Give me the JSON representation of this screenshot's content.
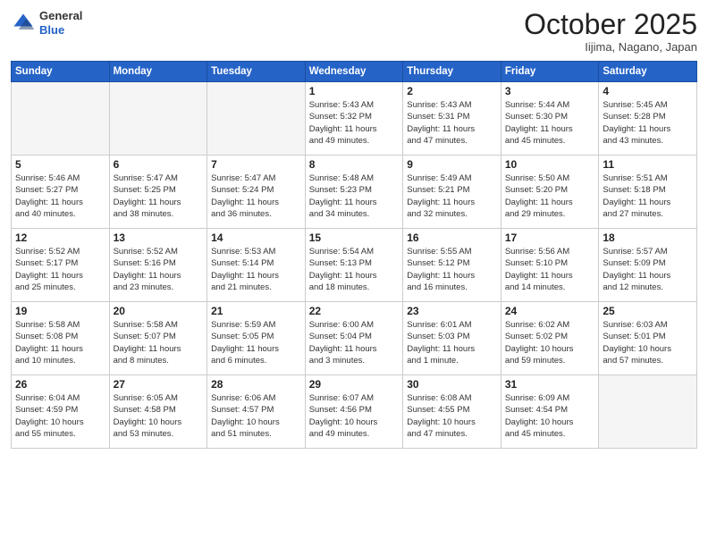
{
  "header": {
    "logo_line1": "General",
    "logo_line2": "Blue",
    "month": "October 2025",
    "location": "Iijima, Nagano, Japan"
  },
  "weekdays": [
    "Sunday",
    "Monday",
    "Tuesday",
    "Wednesday",
    "Thursday",
    "Friday",
    "Saturday"
  ],
  "weeks": [
    [
      {
        "day": "",
        "info": ""
      },
      {
        "day": "",
        "info": ""
      },
      {
        "day": "",
        "info": ""
      },
      {
        "day": "1",
        "info": "Sunrise: 5:43 AM\nSunset: 5:32 PM\nDaylight: 11 hours\nand 49 minutes."
      },
      {
        "day": "2",
        "info": "Sunrise: 5:43 AM\nSunset: 5:31 PM\nDaylight: 11 hours\nand 47 minutes."
      },
      {
        "day": "3",
        "info": "Sunrise: 5:44 AM\nSunset: 5:30 PM\nDaylight: 11 hours\nand 45 minutes."
      },
      {
        "day": "4",
        "info": "Sunrise: 5:45 AM\nSunset: 5:28 PM\nDaylight: 11 hours\nand 43 minutes."
      }
    ],
    [
      {
        "day": "5",
        "info": "Sunrise: 5:46 AM\nSunset: 5:27 PM\nDaylight: 11 hours\nand 40 minutes."
      },
      {
        "day": "6",
        "info": "Sunrise: 5:47 AM\nSunset: 5:25 PM\nDaylight: 11 hours\nand 38 minutes."
      },
      {
        "day": "7",
        "info": "Sunrise: 5:47 AM\nSunset: 5:24 PM\nDaylight: 11 hours\nand 36 minutes."
      },
      {
        "day": "8",
        "info": "Sunrise: 5:48 AM\nSunset: 5:23 PM\nDaylight: 11 hours\nand 34 minutes."
      },
      {
        "day": "9",
        "info": "Sunrise: 5:49 AM\nSunset: 5:21 PM\nDaylight: 11 hours\nand 32 minutes."
      },
      {
        "day": "10",
        "info": "Sunrise: 5:50 AM\nSunset: 5:20 PM\nDaylight: 11 hours\nand 29 minutes."
      },
      {
        "day": "11",
        "info": "Sunrise: 5:51 AM\nSunset: 5:18 PM\nDaylight: 11 hours\nand 27 minutes."
      }
    ],
    [
      {
        "day": "12",
        "info": "Sunrise: 5:52 AM\nSunset: 5:17 PM\nDaylight: 11 hours\nand 25 minutes."
      },
      {
        "day": "13",
        "info": "Sunrise: 5:52 AM\nSunset: 5:16 PM\nDaylight: 11 hours\nand 23 minutes."
      },
      {
        "day": "14",
        "info": "Sunrise: 5:53 AM\nSunset: 5:14 PM\nDaylight: 11 hours\nand 21 minutes."
      },
      {
        "day": "15",
        "info": "Sunrise: 5:54 AM\nSunset: 5:13 PM\nDaylight: 11 hours\nand 18 minutes."
      },
      {
        "day": "16",
        "info": "Sunrise: 5:55 AM\nSunset: 5:12 PM\nDaylight: 11 hours\nand 16 minutes."
      },
      {
        "day": "17",
        "info": "Sunrise: 5:56 AM\nSunset: 5:10 PM\nDaylight: 11 hours\nand 14 minutes."
      },
      {
        "day": "18",
        "info": "Sunrise: 5:57 AM\nSunset: 5:09 PM\nDaylight: 11 hours\nand 12 minutes."
      }
    ],
    [
      {
        "day": "19",
        "info": "Sunrise: 5:58 AM\nSunset: 5:08 PM\nDaylight: 11 hours\nand 10 minutes."
      },
      {
        "day": "20",
        "info": "Sunrise: 5:58 AM\nSunset: 5:07 PM\nDaylight: 11 hours\nand 8 minutes."
      },
      {
        "day": "21",
        "info": "Sunrise: 5:59 AM\nSunset: 5:05 PM\nDaylight: 11 hours\nand 6 minutes."
      },
      {
        "day": "22",
        "info": "Sunrise: 6:00 AM\nSunset: 5:04 PM\nDaylight: 11 hours\nand 3 minutes."
      },
      {
        "day": "23",
        "info": "Sunrise: 6:01 AM\nSunset: 5:03 PM\nDaylight: 11 hours\nand 1 minute."
      },
      {
        "day": "24",
        "info": "Sunrise: 6:02 AM\nSunset: 5:02 PM\nDaylight: 10 hours\nand 59 minutes."
      },
      {
        "day": "25",
        "info": "Sunrise: 6:03 AM\nSunset: 5:01 PM\nDaylight: 10 hours\nand 57 minutes."
      }
    ],
    [
      {
        "day": "26",
        "info": "Sunrise: 6:04 AM\nSunset: 4:59 PM\nDaylight: 10 hours\nand 55 minutes."
      },
      {
        "day": "27",
        "info": "Sunrise: 6:05 AM\nSunset: 4:58 PM\nDaylight: 10 hours\nand 53 minutes."
      },
      {
        "day": "28",
        "info": "Sunrise: 6:06 AM\nSunset: 4:57 PM\nDaylight: 10 hours\nand 51 minutes."
      },
      {
        "day": "29",
        "info": "Sunrise: 6:07 AM\nSunset: 4:56 PM\nDaylight: 10 hours\nand 49 minutes."
      },
      {
        "day": "30",
        "info": "Sunrise: 6:08 AM\nSunset: 4:55 PM\nDaylight: 10 hours\nand 47 minutes."
      },
      {
        "day": "31",
        "info": "Sunrise: 6:09 AM\nSunset: 4:54 PM\nDaylight: 10 hours\nand 45 minutes."
      },
      {
        "day": "",
        "info": ""
      }
    ]
  ]
}
